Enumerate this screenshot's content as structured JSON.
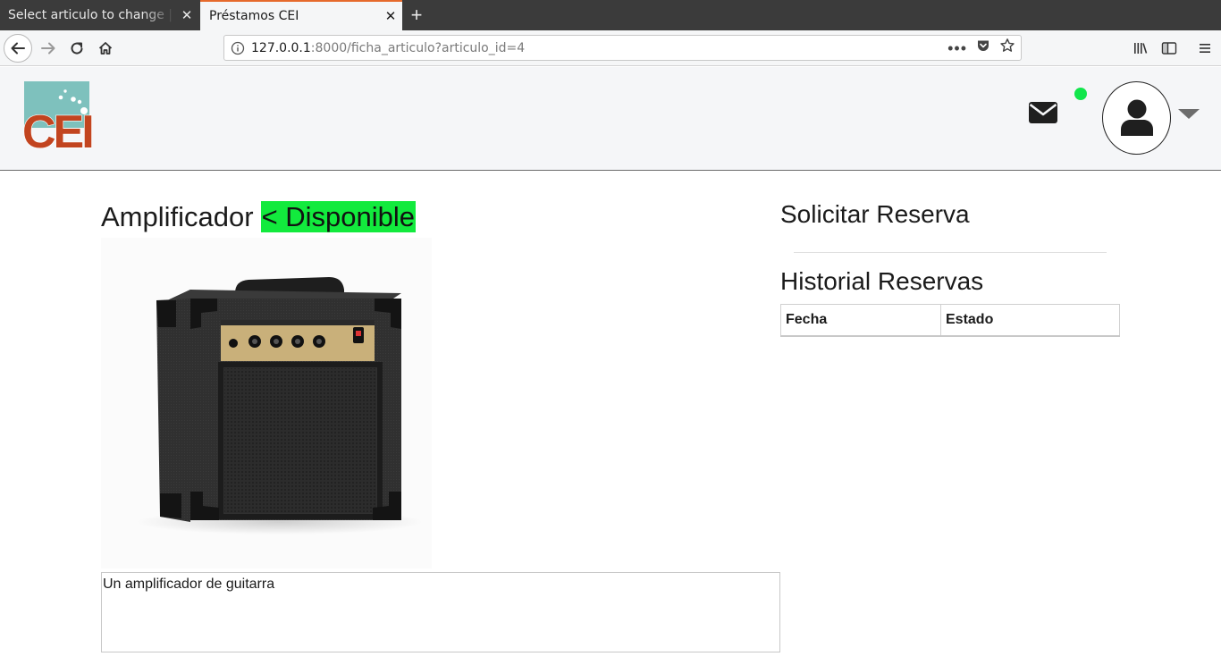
{
  "browser": {
    "tabs": [
      {
        "title": "Select articulo to change | D",
        "active": false
      },
      {
        "title": "Préstamos CEI",
        "active": true
      }
    ],
    "url": {
      "host": "127.0.0.1",
      "rest": ":8000/ficha_articulo?articulo_id=4"
    },
    "accent_color": "#e66a2c"
  },
  "header": {
    "logo_text": "CEI",
    "online_status_color": "#12e64c",
    "icons": [
      "envelope-icon",
      "user-icon",
      "caret-down-icon"
    ]
  },
  "item": {
    "name": "Amplificador",
    "status": "< Disponible",
    "status_color": "#12ea3d",
    "image_alt": "amplificador",
    "description": "Un amplificador de guitarra"
  },
  "sidebar": {
    "request_title": "Solicitar Reserva",
    "history_title": "Historial Reservas",
    "history_columns": [
      "Fecha",
      "Estado"
    ],
    "history_rows": []
  }
}
